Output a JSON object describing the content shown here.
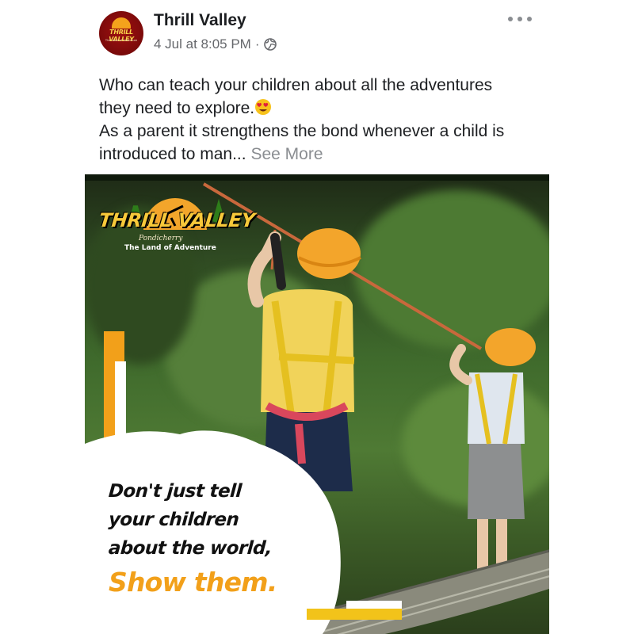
{
  "post": {
    "page_name": "Thrill Valley",
    "timestamp": "4 Jul at 8:05 PM",
    "separator": "·",
    "audience_icon": "globe-icon",
    "menu_icon": "more-options-icon",
    "avatar": {
      "brand": "THRILL VALLEY",
      "sub": "The Land of Adventure"
    },
    "text": {
      "line1": "Who can teach your children about all the adventures",
      "line2": "they need to explore.",
      "emoji": "heart-eyes-emoji",
      "line3": "As a parent it strengthens the bond whenever a child is",
      "line4": "introduced to man...",
      "see_more": "See More"
    }
  },
  "image": {
    "logo_title": "THRILL VALLEY",
    "logo_place": "Pondicherry",
    "logo_tagline": "The Land of Adventure",
    "quote_lines": [
      "Don't just tell",
      "your children",
      "about the world,"
    ],
    "quote_cta": "Show them.",
    "colors": {
      "accent": "#f2a01a",
      "text": "#111111"
    }
  },
  "colors": {
    "primary_text": "#1c1e21",
    "secondary_text": "#65676b",
    "see_more": "#8a8d91"
  }
}
